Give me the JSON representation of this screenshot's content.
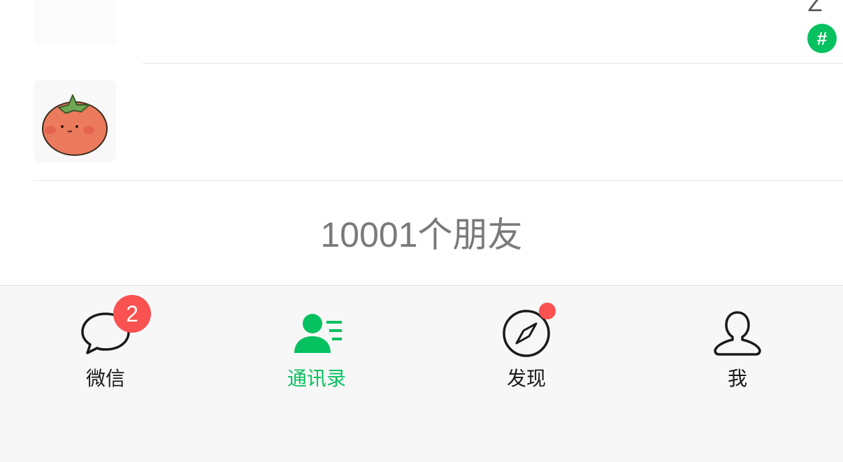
{
  "contacts": {
    "index_letter": "Z",
    "index_hash": "#",
    "friend_count": "10001个朋友",
    "rows": [
      {
        "avatar_icon": "blank-avatar"
      },
      {
        "avatar_icon": "tomato-avatar"
      }
    ]
  },
  "tabbar": {
    "tabs": [
      {
        "label": "微信",
        "icon": "chat-bubble-icon",
        "badge": "2",
        "active": false
      },
      {
        "label": "通讯录",
        "icon": "contacts-icon",
        "active": true
      },
      {
        "label": "发现",
        "icon": "compass-icon",
        "dot": true,
        "active": false
      },
      {
        "label": "我",
        "icon": "person-icon",
        "active": false
      }
    ]
  },
  "colors": {
    "accent": "#07c160",
    "badge": "#fa5151",
    "text_secondary": "#7a7a7a",
    "tabbar_bg": "#f7f7f7"
  }
}
